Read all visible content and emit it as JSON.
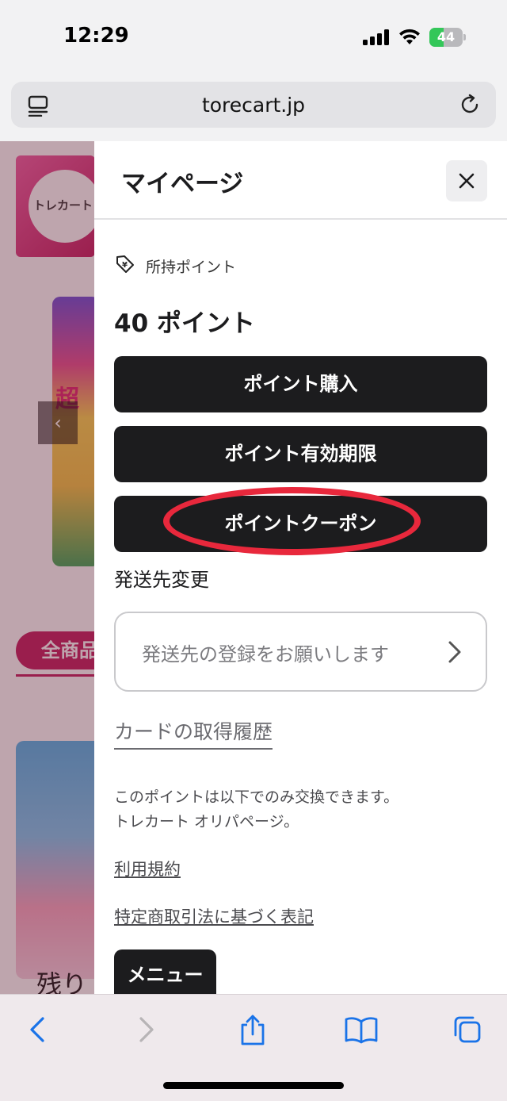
{
  "status": {
    "time": "12:29",
    "battery": "44",
    "battery_level": 0.44
  },
  "browser": {
    "url": "torecart.jp"
  },
  "site": {
    "logo_text": "トレカート",
    "card_text": "超",
    "tab_label": "全商品",
    "card_bottom_text": "残り"
  },
  "drawer": {
    "title": "マイページ",
    "points_label": "所持ポイント",
    "points_value": "40 ポイント",
    "buttons": [
      "ポイント購入",
      "ポイント有効期限",
      "ポイントクーポン"
    ],
    "shipping_heading": "発送先変更",
    "shipping_placeholder": "発送先の登録をお願いします",
    "history_link": "カードの取得履歴",
    "notice_line1": "このポイントは以下でのみ交換できます。",
    "notice_line2": "トレカート オリパページ。",
    "terms_link": "利用規約",
    "law_link": "特定商取引法に基づく表記",
    "menu_button": "メニュー"
  },
  "colors": {
    "button_bg": "#1c1c1e",
    "highlight": "#e8283c",
    "accent": "#c2185b",
    "link_ios": "#1a73e8"
  },
  "icons": {
    "reader": "reader-mode-icon",
    "reload": "reload-icon",
    "close": "close-icon",
    "points": "price-tag-yen-icon",
    "chevron": "chevron-right-icon",
    "back": "back-icon",
    "forward": "forward-icon",
    "share": "share-icon",
    "bookmarks": "bookmarks-icon",
    "tabs": "tabs-icon"
  }
}
